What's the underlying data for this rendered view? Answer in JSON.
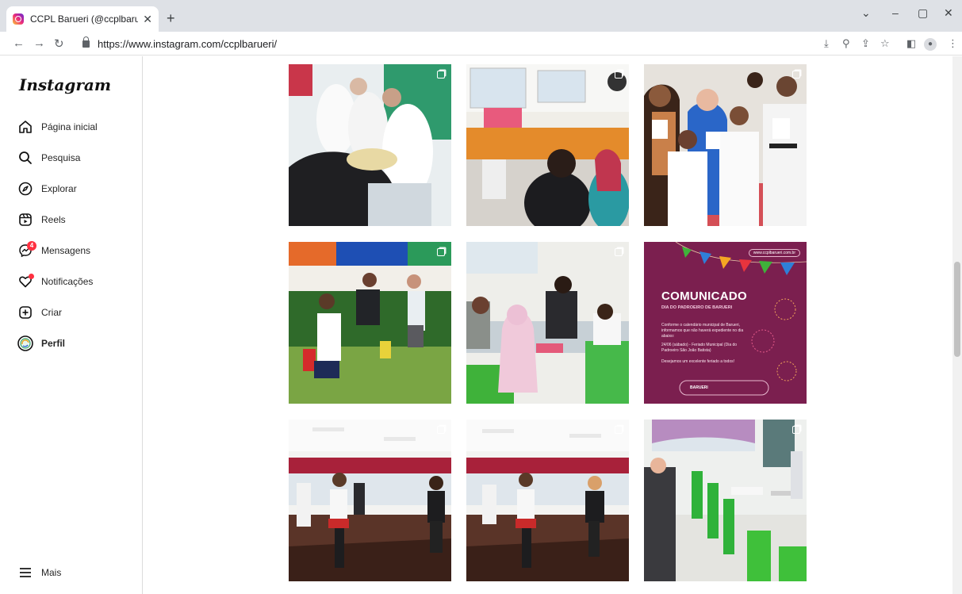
{
  "browser": {
    "tab_title": "CCPL Barueri (@ccplbarueri) • Fo",
    "tab_close": "✕",
    "new_tab": "+",
    "url": "https://www.instagram.com/ccplbarueri/"
  },
  "sidebar": {
    "logo": "Instagram",
    "items": [
      {
        "label": "Página inicial",
        "icon": "home-icon"
      },
      {
        "label": "Pesquisa",
        "icon": "search-icon"
      },
      {
        "label": "Explorar",
        "icon": "compass-icon"
      },
      {
        "label": "Reels",
        "icon": "reels-icon"
      },
      {
        "label": "Mensagens",
        "icon": "messenger-icon",
        "badge": "4"
      },
      {
        "label": "Notificações",
        "icon": "heart-icon"
      },
      {
        "label": "Criar",
        "icon": "plus-square-icon"
      },
      {
        "label": "Perfil",
        "icon": "avatar"
      }
    ],
    "more": "Mais"
  },
  "posts": [
    {
      "kind": "photo",
      "subject": "dental students in lab coats"
    },
    {
      "kind": "photo",
      "subject": "classroom with screen"
    },
    {
      "kind": "photo",
      "subject": "karate students with certificates"
    },
    {
      "kind": "photo",
      "subject": "kids playing outdoors"
    },
    {
      "kind": "photo",
      "subject": "students at table"
    },
    {
      "kind": "graphic",
      "url": "www.ccplbarueri.com.br",
      "title": "COMUNICADO",
      "subtitle": "DIA DO PADROEIRO DE BARUERI",
      "body1": "Conforme o calendário municipal de Barueri, informamos que não haverá expediente no dia abaixo:",
      "body2": "24/06 (sábado) - Feriado Municipal (Dia do Padroeiro São João Batista)",
      "body3": "Desejamos um excelente feriado a todos!",
      "footer": "BARUERI"
    },
    {
      "kind": "photo",
      "subject": "belly dance class"
    },
    {
      "kind": "photo",
      "subject": "belly dance class"
    },
    {
      "kind": "photo",
      "subject": "classroom with green chairs"
    }
  ],
  "colors": {
    "graphic_bg": "#7b1f4f",
    "badge": "#ff3040"
  }
}
